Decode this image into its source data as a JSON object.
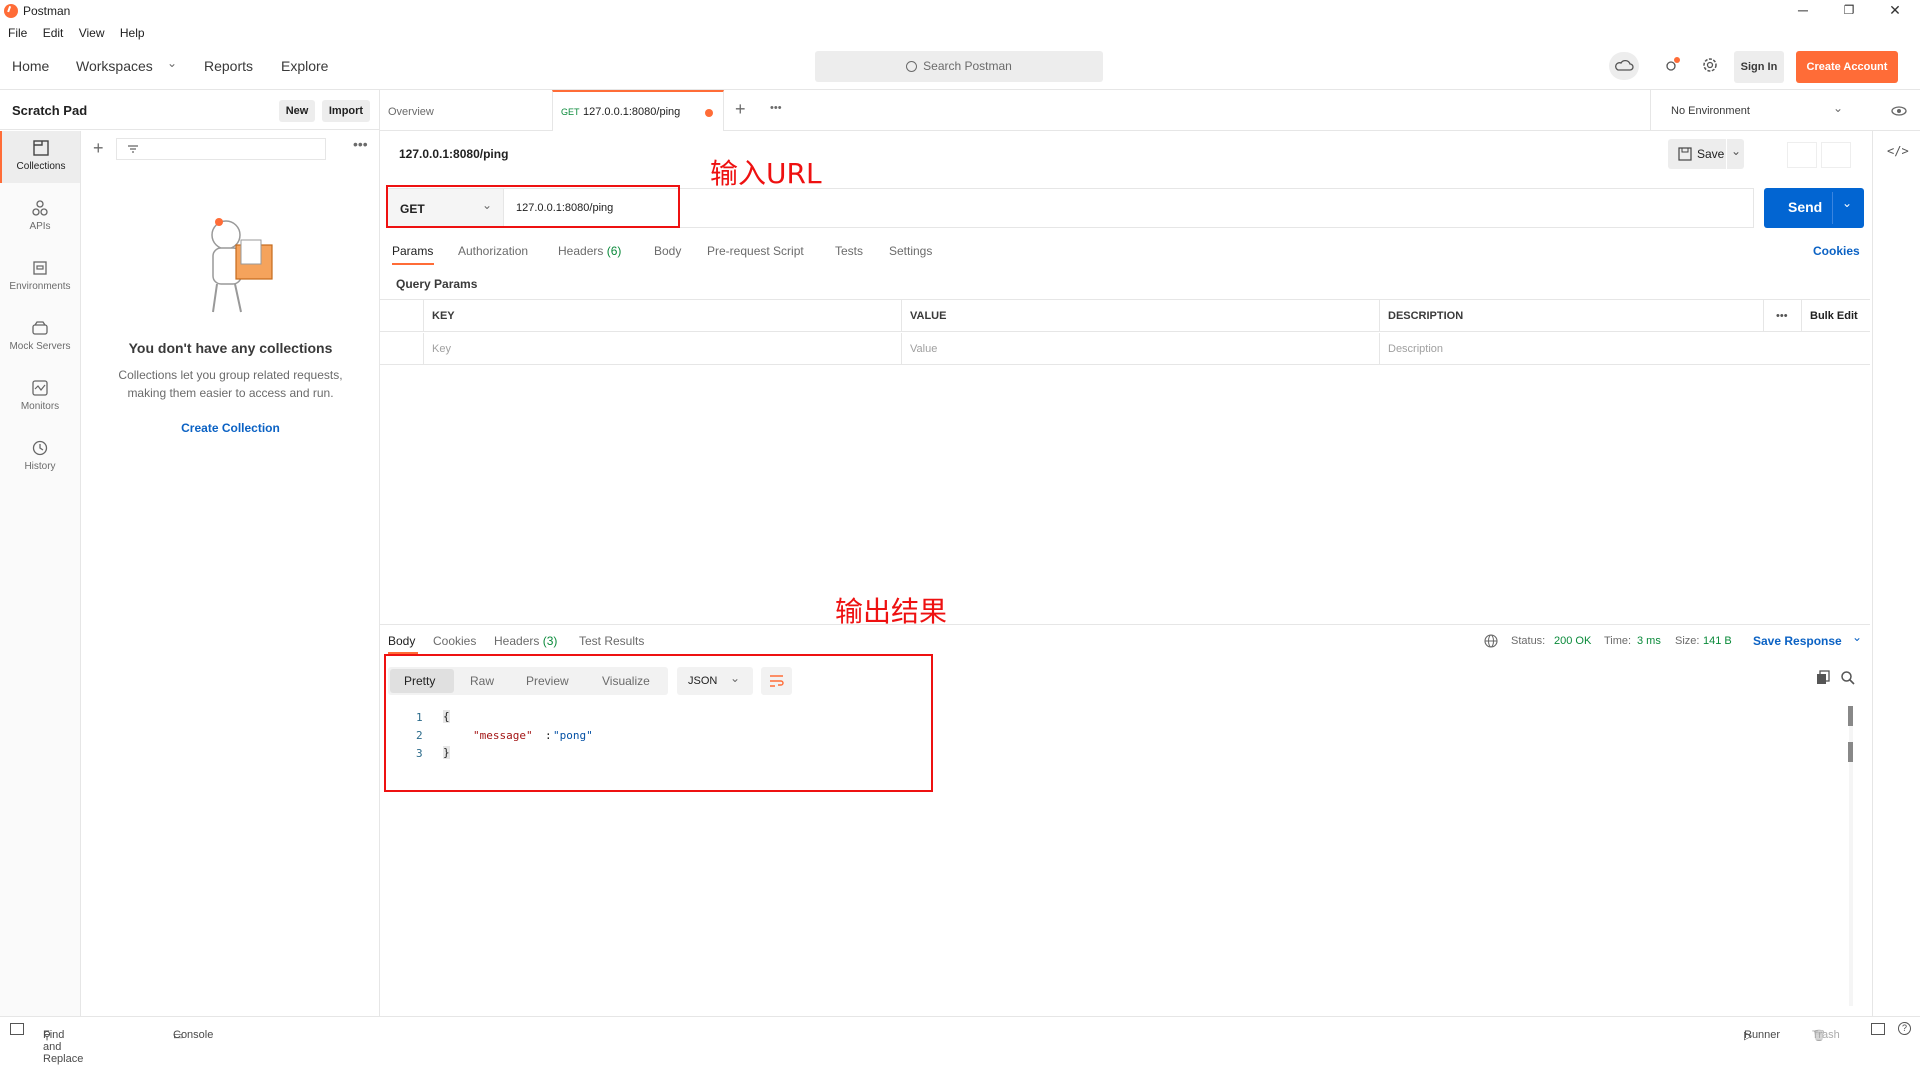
{
  "window": {
    "title": "Postman",
    "controls": [
      "─",
      "❐",
      "✕"
    ]
  },
  "menu": [
    "File",
    "Edit",
    "View",
    "Help"
  ],
  "header": {
    "nav": [
      "Home",
      "Workspaces",
      "Reports",
      "Explore"
    ],
    "search_placeholder": "Search Postman",
    "sign_in": "Sign In",
    "create_account": "Create Account"
  },
  "sidebar": {
    "title": "Scratch Pad",
    "new_label": "New",
    "import_label": "Import",
    "rail": [
      {
        "label": "Collections",
        "icon": "collections-icon"
      },
      {
        "label": "APIs",
        "icon": "apis-icon"
      },
      {
        "label": "Environments",
        "icon": "environments-icon"
      },
      {
        "label": "Mock Servers",
        "icon": "mock-servers-icon"
      },
      {
        "label": "Monitors",
        "icon": "monitors-icon"
      },
      {
        "label": "History",
        "icon": "history-icon"
      }
    ],
    "empty_title": "You don't have any collections",
    "empty_text_1": "Collections let you group related requests,",
    "empty_text_2": "making them easier to access and run.",
    "create_collection": "Create Collection"
  },
  "tabs": {
    "overview": "Overview",
    "active_method": "GET",
    "active_url": "127.0.0.1:8080/ping",
    "environment": "No Environment"
  },
  "request": {
    "name": "127.0.0.1:8080/ping",
    "save_label": "Save",
    "method": "GET",
    "url": "127.0.0.1:8080/ping",
    "send_label": "Send",
    "tabs": [
      "Params",
      "Authorization",
      "Headers",
      "Body",
      "Pre-request Script",
      "Tests",
      "Settings"
    ],
    "headers_count": "(6)",
    "cookies_label": "Cookies",
    "query_params_title": "Query Params",
    "columns": [
      "KEY",
      "VALUE",
      "DESCRIPTION"
    ],
    "bulk_edit": "Bulk Edit",
    "placeholders": [
      "Key",
      "Value",
      "Description"
    ]
  },
  "annotations": {
    "input_url": "输入URL",
    "output_result": "输出结果"
  },
  "response": {
    "tabs": [
      "Body",
      "Cookies",
      "Headers",
      "Test Results"
    ],
    "headers_count": "(3)",
    "status_label": "Status:",
    "status_value": "200 OK",
    "time_label": "Time:",
    "time_value": "3 ms",
    "size_label": "Size:",
    "size_value": "141 B",
    "save_response": "Save Response",
    "view_tabs": [
      "Pretty",
      "Raw",
      "Preview",
      "Visualize"
    ],
    "format": "JSON",
    "lines": [
      "1",
      "2",
      "3"
    ],
    "brace_open": "{",
    "json_key": "\"message\"",
    "json_colon": ":",
    "json_value": "\"pong\"",
    "brace_close": "}"
  },
  "footer": {
    "find_replace": "Find and Replace",
    "console": "Console",
    "runner": "Runner",
    "trash": "Trash"
  },
  "colors": {
    "accent": "#ff6c37",
    "send": "#0265d2",
    "link": "#0b62c4",
    "status_ok": "#0a8a3a",
    "annotation": "#e11111"
  }
}
